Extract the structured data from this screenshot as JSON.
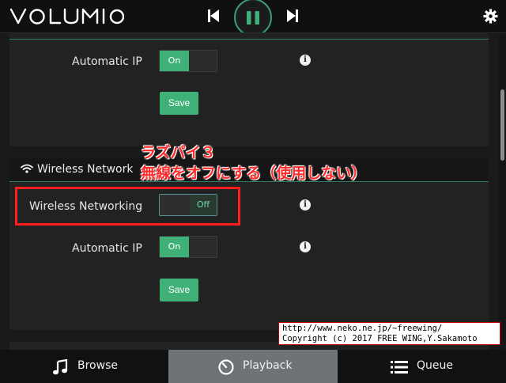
{
  "app": {
    "logo_text": "VOLUMIO"
  },
  "header": {
    "prev_icon": "skip-previous-icon",
    "pause_icon": "pause-icon",
    "next_icon": "skip-next-icon",
    "settings_icon": "gear-icon"
  },
  "network_section": {
    "automatic_ip_label": "Automatic IP",
    "automatic_ip_state": "On",
    "save_label": "Save"
  },
  "wireless_section": {
    "header_icon": "wifi-icon",
    "header_title": "Wireless Network",
    "wireless_networking_label": "Wireless Networking",
    "wireless_networking_state": "Off",
    "automatic_ip_label": "Automatic IP",
    "automatic_ip_state": "On",
    "save_label": "Save"
  },
  "annotation": {
    "line1": "ラズパイ３",
    "line2": "無線をオフにする（使用しない）",
    "color": "#ff2b2b"
  },
  "copyright": {
    "line1": "http://www.neko.ne.jp/~freewing/",
    "line2": "Copyright (c) 2017 FREE WING,Y.Sakamoto"
  },
  "bottom_nav": {
    "browse_label": "Browse",
    "playback_label": "Playback",
    "queue_label": "Queue"
  },
  "colors": {
    "accent": "#3eb078",
    "active_tab": "#6e7378",
    "background": "#1a1a1a"
  }
}
